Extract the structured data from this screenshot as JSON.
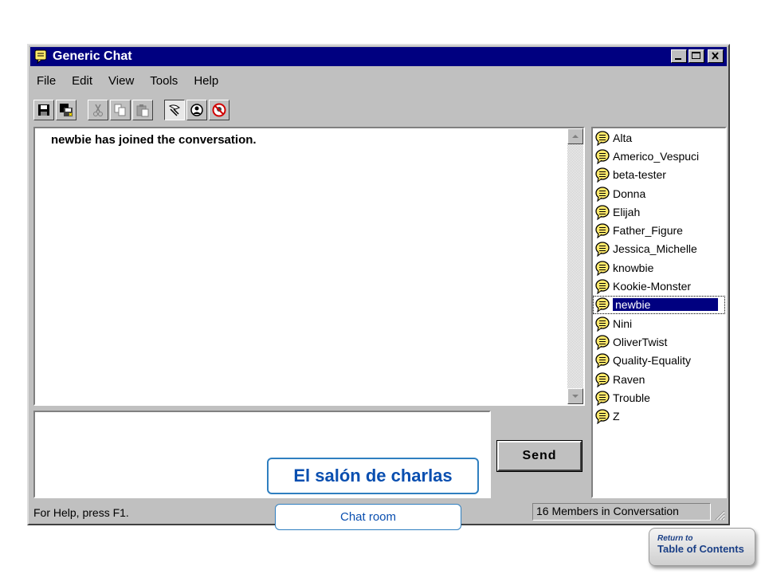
{
  "window": {
    "title": "Generic Chat",
    "menu": [
      "File",
      "Edit",
      "View",
      "Tools",
      "Help"
    ]
  },
  "conversation": {
    "messages": [
      "newbie has joined the conversation."
    ]
  },
  "members": [
    "Alta",
    "Americo_Vespuci",
    "beta-tester",
    "Donna",
    "Elijah",
    "Father_Figure",
    "Jessica_Michelle",
    "knowbie",
    "Kookie-Monster",
    "newbie",
    "Nini",
    "OliverTwist",
    "Quality-Equality",
    "Raven",
    "Trouble",
    "Z"
  ],
  "selected_member": "newbie",
  "send_label": "Send",
  "status": {
    "help": "For Help, press F1.",
    "members_count": "16 Members in Conversation"
  },
  "callouts": {
    "title_es": "El salón de charlas",
    "title_en": "Chat room"
  },
  "toc": {
    "line1": "Return to",
    "line2": "Table of Contents"
  },
  "colors": {
    "titlebar": "#000080",
    "selection": "#000080",
    "callout_border": "#2f7fc0",
    "callout_text": "#0a4fb0"
  },
  "toolbar_icons": [
    "save-icon",
    "save-all-icon",
    "cut-icon",
    "copy-icon",
    "paste-icon",
    "whisper-icon",
    "members-icon",
    "ignore-icon"
  ]
}
